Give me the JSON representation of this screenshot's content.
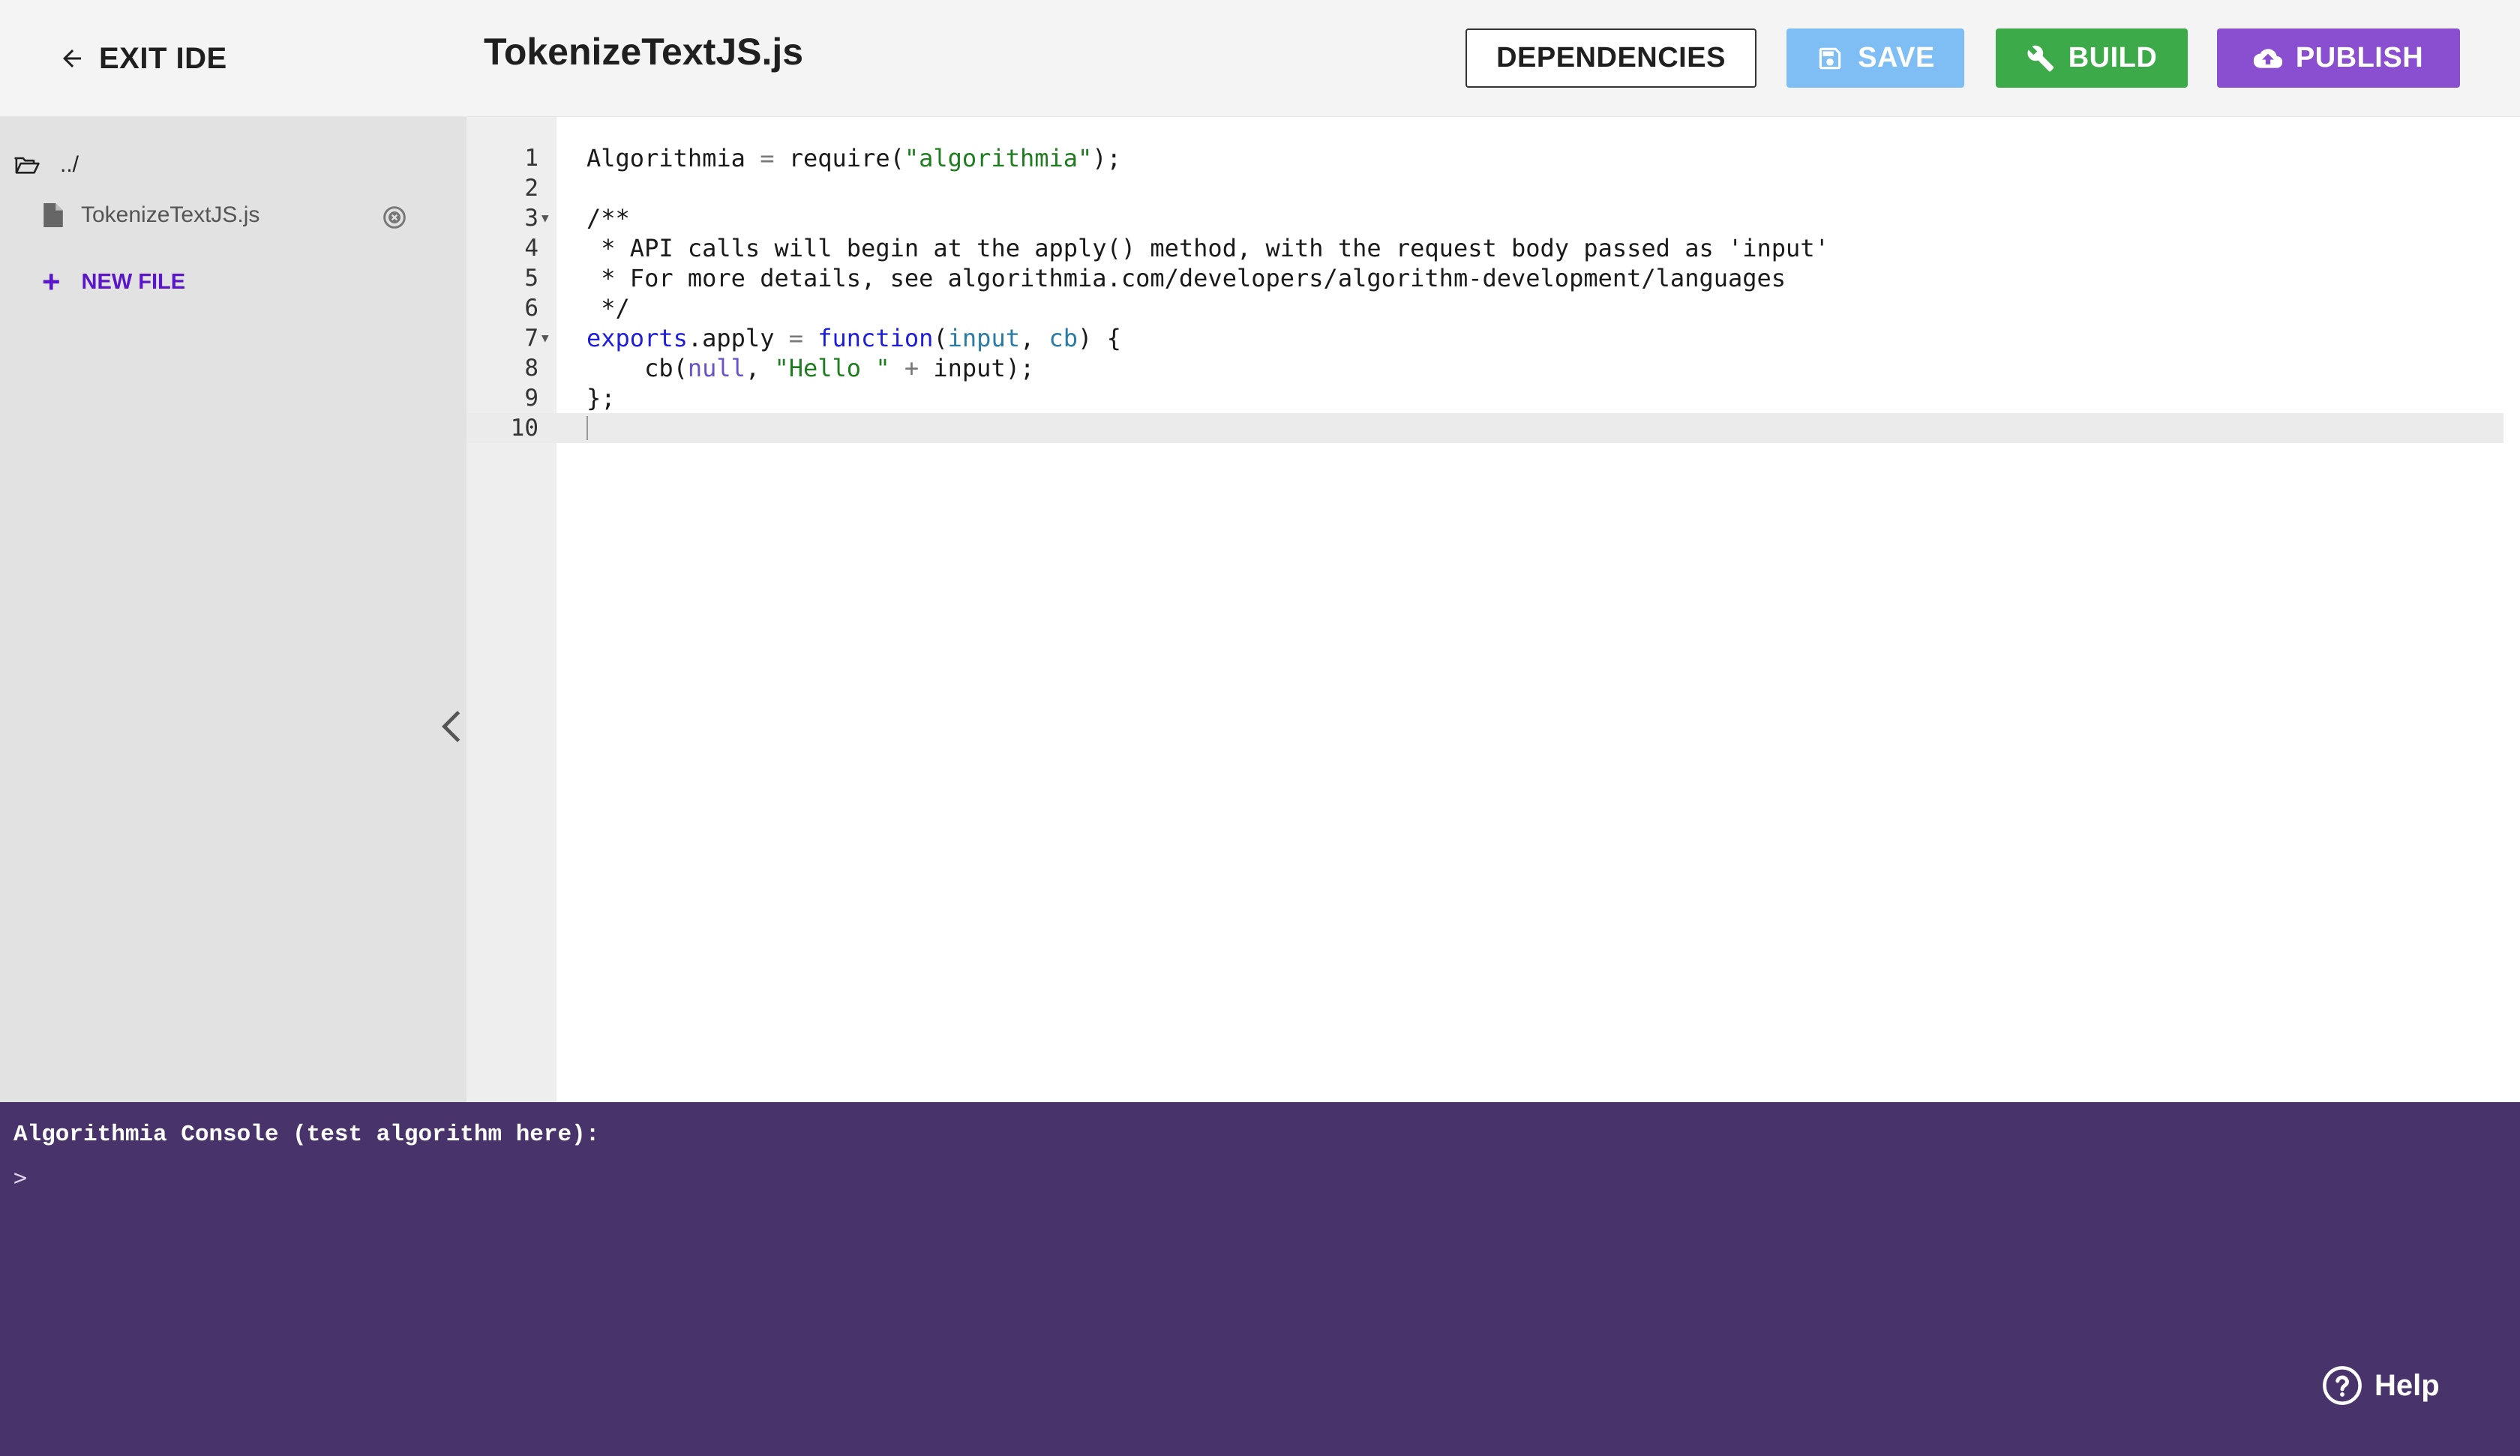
{
  "header": {
    "exit_label": "EXIT IDE",
    "file_title": "TokenizeTextJS.js",
    "dependencies_label": "DEPENDENCIES",
    "save_label": "SAVE",
    "build_label": "BUILD",
    "publish_label": "PUBLISH"
  },
  "sidebar": {
    "parent_dir": "../",
    "file_name": "TokenizeTextJS.js",
    "new_file_label": "NEW FILE"
  },
  "editor": {
    "line_numbers": [
      "1",
      "2",
      "3",
      "4",
      "5",
      "6",
      "7",
      "8",
      "9",
      "10"
    ],
    "active_line": "10",
    "fold_markers": [
      "3",
      "7"
    ]
  },
  "console": {
    "title": "Algorithmia Console (test algorithm here):",
    "prompt": ">"
  },
  "help": {
    "label": "Help"
  },
  "colors": {
    "header_bg": "#f4f4f4",
    "save": "#7ebef4",
    "build": "#3daa4a",
    "publish": "#8a4fd1",
    "new_file_accent": "#5a16c7",
    "console_bg": "#48336a",
    "sidebar_bg": "#e2e2e2",
    "gutter_bg": "#eeeeee"
  },
  "icons": {
    "exit": "arrow-left-icon",
    "save": "floppy-disk-icon",
    "build": "wrench-icon",
    "publish": "cloud-upload-icon",
    "folder": "folder-open-icon",
    "file": "file-icon",
    "close": "close-circle-icon",
    "collapse": "chevron-left-icon",
    "help": "question-circle-icon"
  }
}
